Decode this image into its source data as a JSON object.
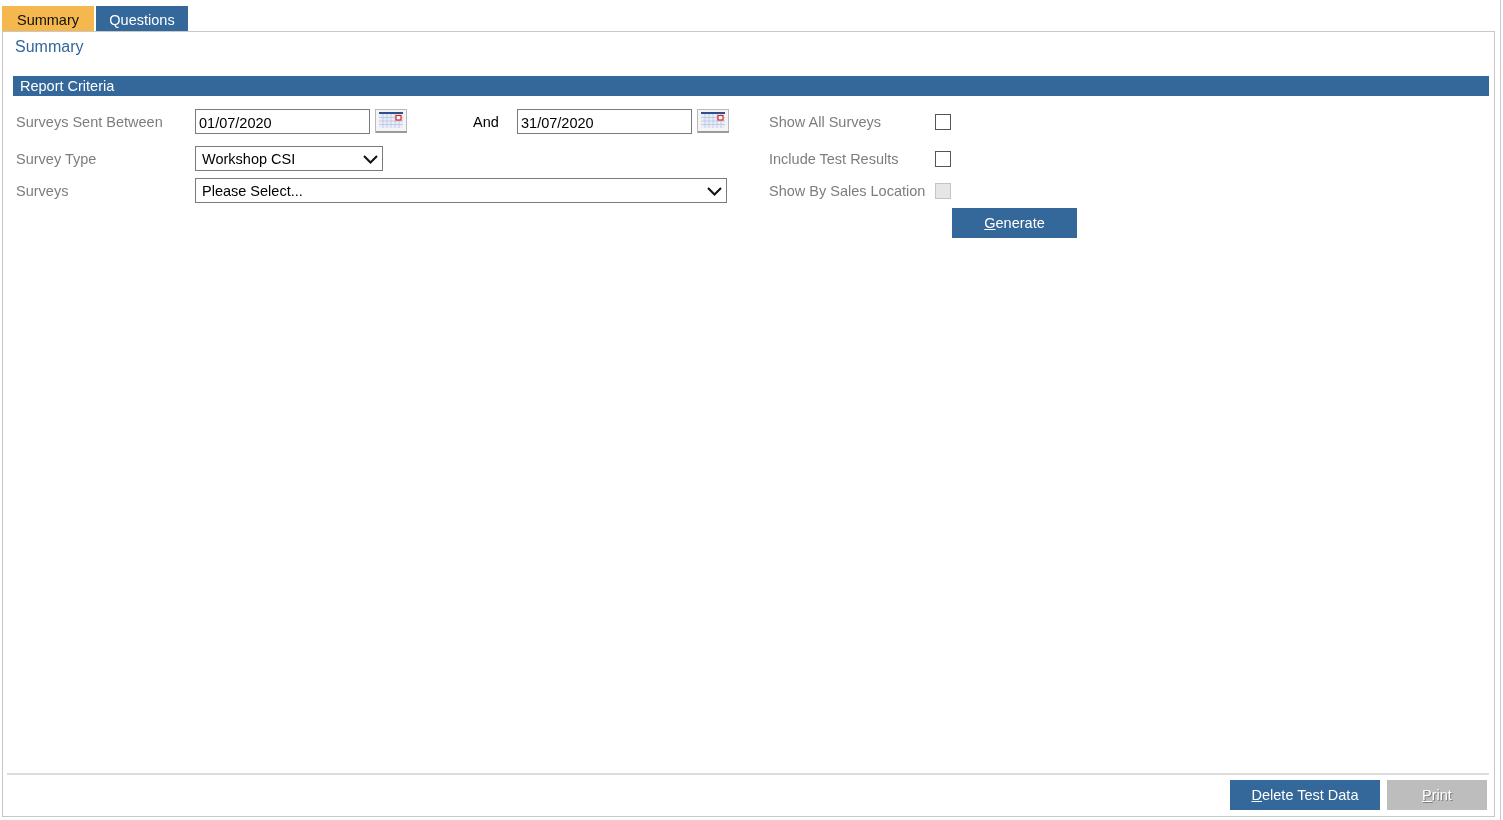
{
  "tabs": [
    {
      "label": "Summary",
      "selected": true
    },
    {
      "label": "Questions",
      "selected": false
    }
  ],
  "page_title": "Summary",
  "section": {
    "title": "Report Criteria"
  },
  "criteria": {
    "date_range": {
      "label": "Surveys Sent Between",
      "from": "01/07/2020",
      "joiner": "And",
      "to": "31/07/2020"
    },
    "survey_type": {
      "label": "Survey Type",
      "value": "Workshop CSI"
    },
    "surveys": {
      "label": "Surveys",
      "value": "Please Select..."
    }
  },
  "options": [
    {
      "label": "Show All Surveys",
      "checked": false,
      "disabled": false
    },
    {
      "label": "Include Test Results",
      "checked": false,
      "disabled": false
    },
    {
      "label": "Show By Sales Location",
      "checked": false,
      "disabled": true
    }
  ],
  "generate_button": {
    "label": "Generate"
  },
  "footer_buttons": [
    {
      "label": "Delete Test Data",
      "disabled": false
    },
    {
      "label": "Print",
      "disabled": true
    }
  ]
}
